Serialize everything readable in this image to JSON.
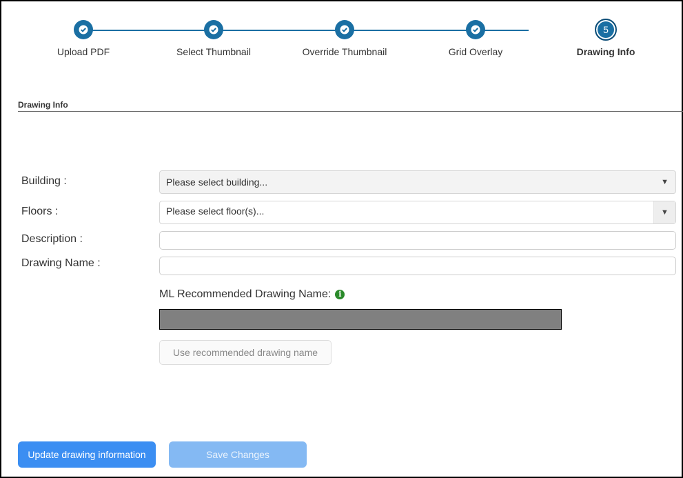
{
  "stepper": {
    "steps": [
      {
        "label": "Upload PDF",
        "state": "complete",
        "icon": "check-icon"
      },
      {
        "label": "Select Thumbnail",
        "state": "complete",
        "icon": "check-icon"
      },
      {
        "label": "Override Thumbnail",
        "state": "complete",
        "icon": "check-icon"
      },
      {
        "label": "Grid Overlay",
        "state": "complete",
        "icon": "check-icon"
      },
      {
        "label": "Drawing Info",
        "state": "active",
        "number": "5"
      }
    ],
    "accent": "#1a6fa3"
  },
  "section": {
    "title": "Drawing Info"
  },
  "form": {
    "building_label": "Building :",
    "building_placeholder": "Please select building...",
    "floors_label": "Floors :",
    "floors_placeholder": "Please select floor(s)...",
    "description_label": "Description :",
    "description_value": "",
    "drawing_name_label": "Drawing Name :",
    "drawing_name_value": "",
    "ml_label": "ML Recommended Drawing Name:",
    "ml_info_icon": "info-icon",
    "use_recommended_label": "Use recommended drawing name"
  },
  "actions": {
    "update_label": "Update drawing information",
    "save_label": "Save Changes",
    "primary_color": "#3b8ef2",
    "disabled_color": "#84b9f3"
  }
}
